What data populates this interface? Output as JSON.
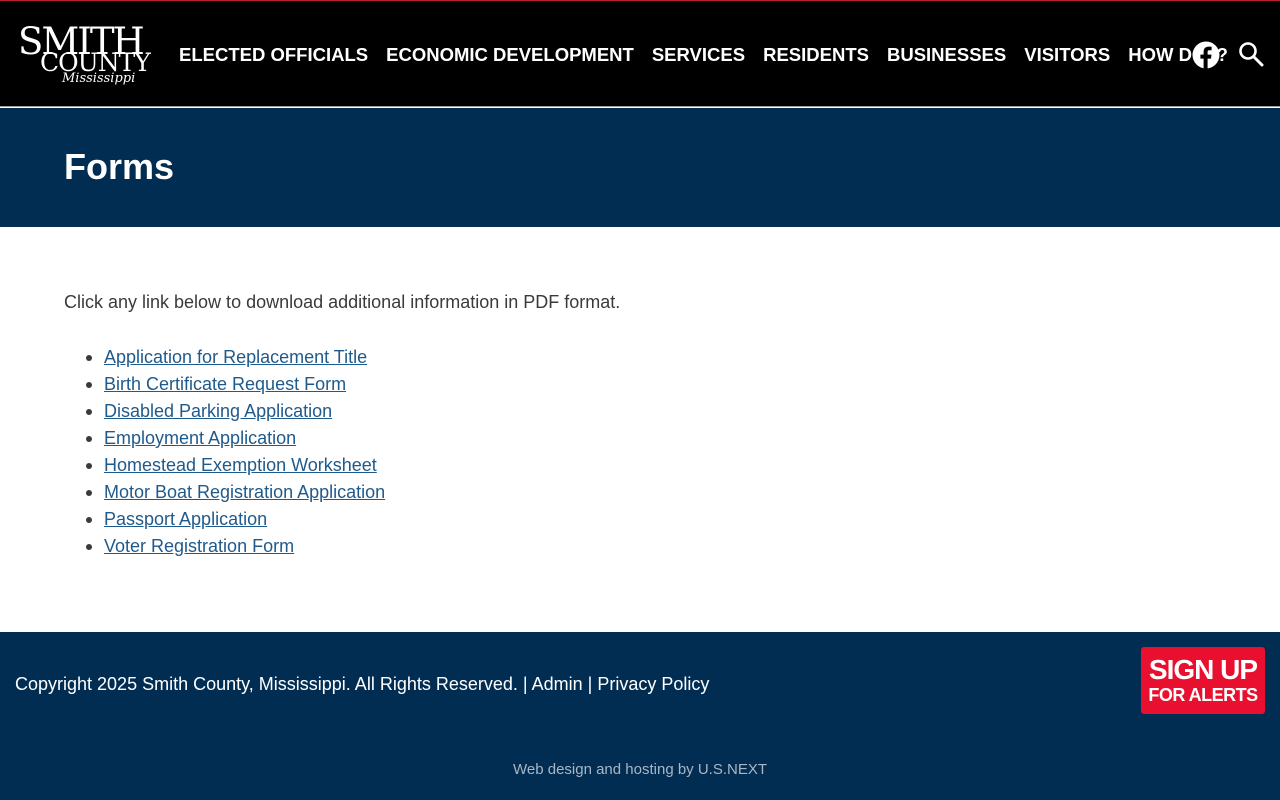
{
  "header": {
    "logo": {
      "line1": "SMITH",
      "line2": "COUNTY",
      "line3": "Mississippi"
    },
    "nav": [
      {
        "label": "ELECTED OFFICIALS"
      },
      {
        "label": "ECONOMIC DEVELOPMENT"
      },
      {
        "label": "SERVICES"
      },
      {
        "label": "RESIDENTS"
      },
      {
        "label": "BUSINESSES"
      },
      {
        "label": "VISITORS"
      },
      {
        "label": "HOW DO I?"
      }
    ],
    "icons": {
      "social": "facebook-icon",
      "search": "search-icon"
    }
  },
  "banner": {
    "title": "Forms"
  },
  "content": {
    "intro": "Click any link below to download additional information in PDF format.",
    "forms": [
      {
        "label": "Application for Replacement Title"
      },
      {
        "label": "Birth Certificate Request Form"
      },
      {
        "label": "Disabled Parking Application"
      },
      {
        "label": "Employment Application"
      },
      {
        "label": "Homestead Exemption Worksheet"
      },
      {
        "label": "Motor Boat Registration Application"
      },
      {
        "label": "Passport Application"
      },
      {
        "label": "Voter Registration Form"
      }
    ]
  },
  "footer": {
    "copyright": "Copyright 2025 Smith County, Mississippi. All Rights Reserved.",
    "separator": "|",
    "admin_label": "Admin",
    "privacy_label": "Privacy Policy",
    "signup_top": "SIGN UP",
    "signup_bottom": "FOR ALERTS",
    "credit": "Web design and hosting by U.S.NEXT"
  },
  "colors": {
    "header_bg": "#000000",
    "navy": "#022d52",
    "link": "#1f5a8c",
    "alert_red": "#e8102e"
  }
}
